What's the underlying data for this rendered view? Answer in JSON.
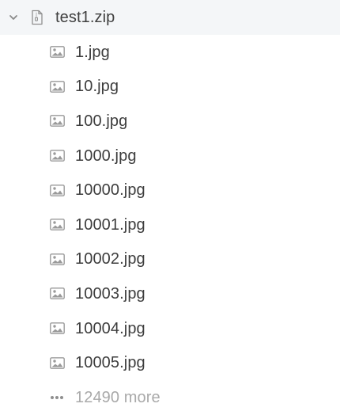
{
  "tree": {
    "root": {
      "name": "test1.zip",
      "expanded": true,
      "chevron_icon": "chevron-down-icon",
      "file_icon": "zip-file-icon"
    },
    "children": [
      {
        "name": "1.jpg",
        "icon": "image-icon"
      },
      {
        "name": "10.jpg",
        "icon": "image-icon"
      },
      {
        "name": "100.jpg",
        "icon": "image-icon"
      },
      {
        "name": "1000.jpg",
        "icon": "image-icon"
      },
      {
        "name": "10000.jpg",
        "icon": "image-icon"
      },
      {
        "name": "10001.jpg",
        "icon": "image-icon"
      },
      {
        "name": "10002.jpg",
        "icon": "image-icon"
      },
      {
        "name": "10003.jpg",
        "icon": "image-icon"
      },
      {
        "name": "10004.jpg",
        "icon": "image-icon"
      },
      {
        "name": "10005.jpg",
        "icon": "image-icon"
      }
    ],
    "more": {
      "label": "12490 more",
      "icon": "ellipsis-icon"
    }
  },
  "colors": {
    "root_row_background": "#f4f6f8",
    "text": "#3d3d3d",
    "muted_text": "#a9a9a9",
    "icon": "#9a9a9a"
  }
}
